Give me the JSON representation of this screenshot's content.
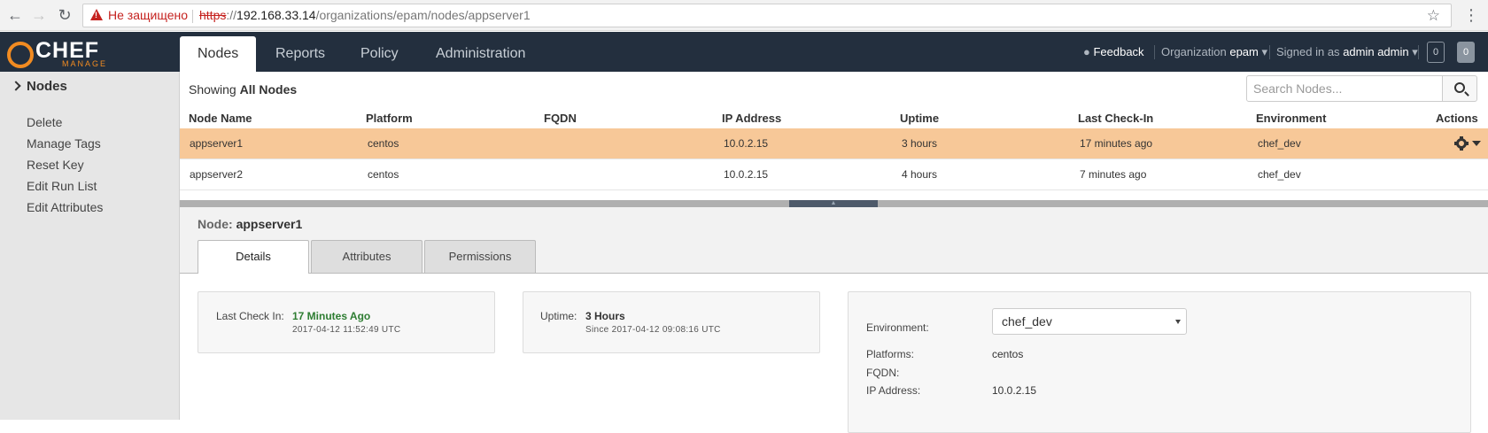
{
  "browser": {
    "security_label": "Не защищено",
    "url_protocol": "https",
    "url_separator": "://",
    "url_host": "192.168.33.14",
    "url_path": "/organizations/epam/nodes/appserver1"
  },
  "topnav": {
    "logo_text": "CHEF",
    "logo_sub": "MANAGE",
    "tabs": [
      "Nodes",
      "Reports",
      "Policy",
      "Administration"
    ],
    "active_tab": "Nodes",
    "feedback": "Feedback",
    "org_label": "Organization",
    "org_value": "epam",
    "signed_label": "Signed in as",
    "signed_user": "admin admin",
    "count_1": "0",
    "count_2": "0"
  },
  "sidebar": {
    "title": "Nodes",
    "items": [
      "Delete",
      "Manage Tags",
      "Reset Key",
      "Edit Run List",
      "Edit Attributes"
    ]
  },
  "main": {
    "showing_prefix": "Showing",
    "showing_value": "All Nodes",
    "search_placeholder": "Search Nodes...",
    "columns": [
      "Node Name",
      "Platform",
      "FQDN",
      "IP Address",
      "Uptime",
      "Last Check-In",
      "Environment",
      "Actions"
    ],
    "rows": [
      {
        "name": "appserver1",
        "platform": "centos",
        "fqdn": "",
        "ip": "10.0.2.15",
        "uptime": "3 hours",
        "checkin": "17 minutes ago",
        "env": "chef_dev",
        "selected": true
      },
      {
        "name": "appserver2",
        "platform": "centos",
        "fqdn": "",
        "ip": "10.0.2.15",
        "uptime": "4 hours",
        "checkin": "7 minutes ago",
        "env": "chef_dev",
        "selected": false
      }
    ]
  },
  "detail": {
    "node_label": "Node:",
    "node_name": "appserver1",
    "tabs": [
      "Details",
      "Attributes",
      "Permissions"
    ],
    "active_tab": "Details",
    "last_checkin_label": "Last Check In:",
    "last_checkin_value": "17 Minutes Ago",
    "last_checkin_time": "2017-04-12 11:52:49 UTC",
    "uptime_label": "Uptime:",
    "uptime_value": "3 Hours",
    "uptime_since": "Since 2017-04-12 09:08:16 UTC",
    "environment_label": "Environment:",
    "environment_value": "chef_dev",
    "platforms_label": "Platforms:",
    "platforms_value": "centos",
    "fqdn_label": "FQDN:",
    "fqdn_value": "",
    "ip_label": "IP Address:",
    "ip_value": "10.0.2.15"
  },
  "colors": {
    "nav_bg": "#232f3e",
    "selected_row": "#f7c898",
    "success_green": "#2e7d32",
    "brand_orange": "#f18b21"
  }
}
